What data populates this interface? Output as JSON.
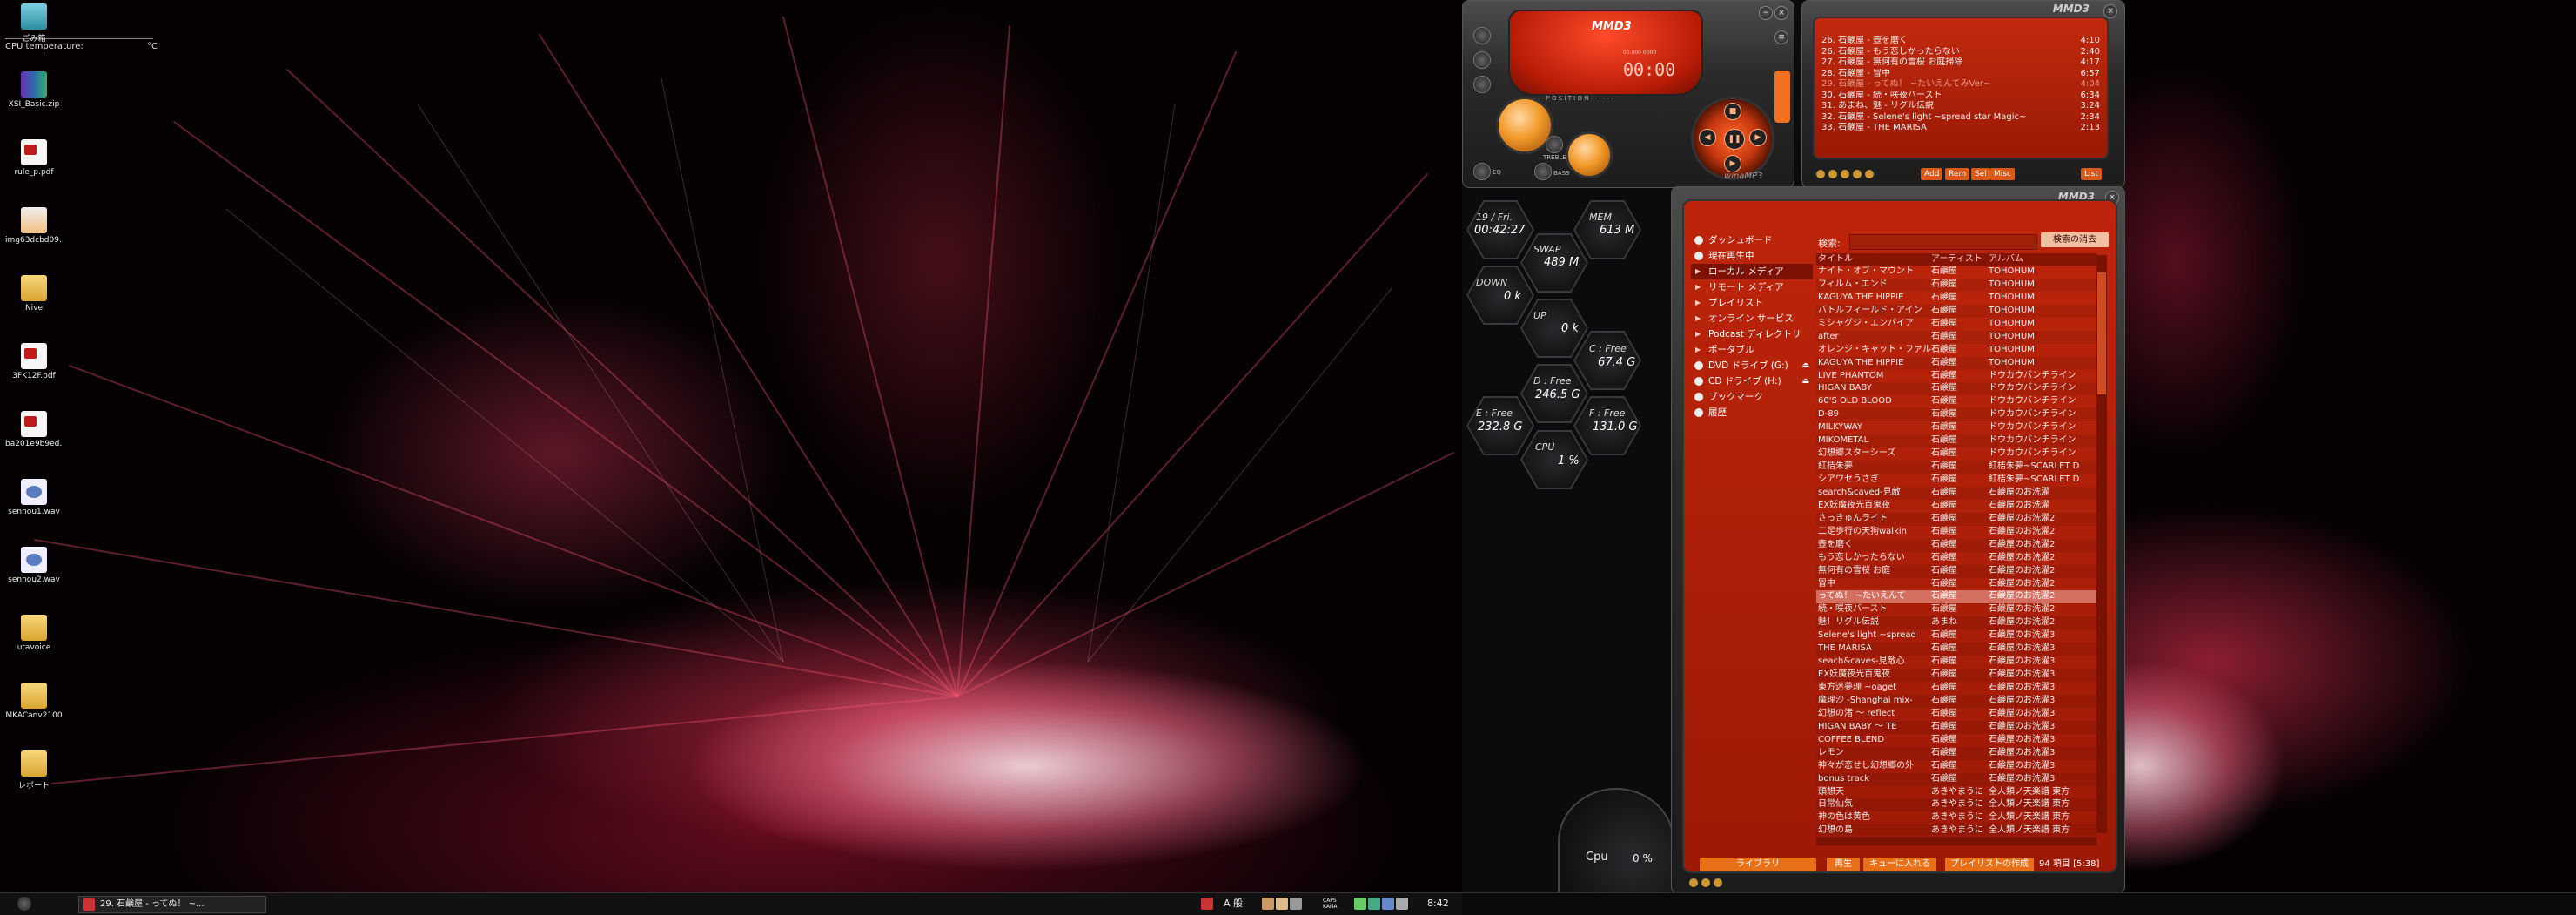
{
  "desktop": {
    "cpu_temp_label": "CPU temperature:",
    "cpu_temp_unit": "°C",
    "icons": [
      {
        "label": "ごみ箱",
        "kind": "bin"
      },
      {
        "label": "XSI_Basic.zip",
        "kind": "zip"
      },
      {
        "label": "rule_p.pdf",
        "kind": "pdf"
      },
      {
        "label": "img63dcbd09...",
        "kind": "img"
      },
      {
        "label": "Nive",
        "kind": "folder"
      },
      {
        "label": "3FK12F.pdf",
        "kind": "pdf"
      },
      {
        "label": "ba201e9b9ed...",
        "kind": "pdf"
      },
      {
        "label": "sennou1.wav",
        "kind": "wav"
      },
      {
        "label": "sennou2.wav",
        "kind": "wav"
      },
      {
        "label": "utavoice",
        "kind": "folder"
      },
      {
        "label": "MKACanv2100",
        "kind": "folder"
      },
      {
        "label": "レポート",
        "kind": "folder"
      }
    ]
  },
  "taskbar": {
    "task_label": "29. 石鹸屋 - ってぬ！ ~...",
    "ime_text": "A 般",
    "caps_text": "CAPS\nKANA",
    "clock": "8:42"
  },
  "meters": {
    "date": "19 / Fri.",
    "time": "00:42:27",
    "mem_label": "MEM",
    "mem_value": "613 M",
    "swap_label": "SWAP",
    "swap_value": "489 M",
    "down_label": "DOWN",
    "down_value": "0 k",
    "up_label": "UP",
    "up_value": "0 k",
    "c_label": "C : Free",
    "c_value": "67.4 G",
    "d_label": "D : Free",
    "d_value": "246.5 G",
    "e_label": "E : Free",
    "e_value": "232.8 G",
    "f_label": "F : Free",
    "f_value": "131.0 G",
    "cpu_label": "CPU",
    "cpu_value": "1 %",
    "dial_label": "Cpu",
    "dial_value": "0 %"
  },
  "player": {
    "brand": "MMD3",
    "lcd_small": "00.000 0000",
    "lcd_time": "00:00",
    "marquee": "- - - - - - P O S I T I O N - - - - - -",
    "bottom_brand": "winaMP3",
    "btn_eq": "EQ",
    "btn_treble": "TREBLE",
    "btn_bass": "BASS"
  },
  "playlist": {
    "brand": "MMD3",
    "rows": [
      {
        "title": "26. 石鹸屋 - 壺を磨く",
        "dur": "4:10",
        "dim": false
      },
      {
        "title": "26. 石鹸屋 - もう恋しかったらない",
        "dur": "2:40",
        "dim": false
      },
      {
        "title": "27. 石鹸屋 - 無何有の雪桜 お庭掃除",
        "dur": "4:17",
        "dim": false
      },
      {
        "title": "28. 石鹸屋 - 冒中",
        "dur": "6:57",
        "dim": false
      },
      {
        "title": "29. 石鹸屋 - ってぬ！ ~たいえんてみVer~",
        "dur": "4:04",
        "dim": true
      },
      {
        "title": "30. 石鹸屋 - 続・咲夜バースト",
        "dur": "6:34",
        "dim": false
      },
      {
        "title": "31. あまね、魅 - リグル伝説",
        "dur": "3:24",
        "dim": false
      },
      {
        "title": "32. 石鹸屋 - Selene's light ~spread star Magic~",
        "dur": "2:34",
        "dim": false
      },
      {
        "title": "33. 石鹸屋 - THE MARISA",
        "dur": "2:13",
        "dim": false
      }
    ],
    "btn_add": "Add",
    "btn_rem": "Rem",
    "btn_sel": "Sel",
    "btn_misc": "Misc",
    "btn_list": "List"
  },
  "library": {
    "brand": "MMD3",
    "nav": [
      {
        "label": "ダッシュボード",
        "sel": false,
        "arrow": false,
        "eject": false
      },
      {
        "label": "現在再生中",
        "sel": false,
        "arrow": false,
        "eject": false
      },
      {
        "label": "ローカル メディア",
        "sel": true,
        "arrow": true,
        "eject": false
      },
      {
        "label": "リモート メディア",
        "sel": false,
        "arrow": true,
        "eject": false
      },
      {
        "label": "プレイリスト",
        "sel": false,
        "arrow": true,
        "eject": false
      },
      {
        "label": "オンライン サービス",
        "sel": false,
        "arrow": true,
        "eject": false
      },
      {
        "label": "Podcast ディレクトリ",
        "sel": false,
        "arrow": true,
        "eject": false
      },
      {
        "label": "ポータブル",
        "sel": false,
        "arrow": true,
        "eject": false
      },
      {
        "label": "DVD ドライブ (G:)",
        "sel": false,
        "arrow": false,
        "eject": true
      },
      {
        "label": "CD ドライブ (H:)",
        "sel": false,
        "arrow": false,
        "eject": true
      },
      {
        "label": "ブックマーク",
        "sel": false,
        "arrow": false,
        "eject": false
      },
      {
        "label": "履歴",
        "sel": false,
        "arrow": false,
        "eject": false
      }
    ],
    "search_label": "検索:",
    "search_value": "",
    "search_clear": "検索の消去",
    "columns": [
      "タイトル",
      "アーティスト",
      "アルバム"
    ],
    "rows": [
      [
        "ナイト・オブ・マウント",
        "石鹸屋",
        "TOHOHUM"
      ],
      [
        "フィルム・エンド",
        "石鹸屋",
        "TOHOHUM"
      ],
      [
        "KAGUYA THE HIPPIE",
        "石鹸屋",
        "TOHOHUM"
      ],
      [
        "バトルフィールド・アイン",
        "石鹸屋",
        "TOHOHUM"
      ],
      [
        "ミシャグジ・エンパイア",
        "石鹸屋",
        "TOHOHUM"
      ],
      [
        "after",
        "石鹸屋",
        "TOHOHUM"
      ],
      [
        "オレンジ・キャット・ファル",
        "石鹸屋",
        "TOHOHUM"
      ],
      [
        "KAGUYA THE HIPPIE",
        "石鹸屋",
        "TOHOHUM"
      ],
      [
        "LIVE PHANTOM",
        "石鹸屋",
        "ドウカウバンチライン"
      ],
      [
        "HIGAN BABY",
        "石鹸屋",
        "ドウカウバンチライン"
      ],
      [
        "60'S OLD BLOOD",
        "石鹸屋",
        "ドウカウバンチライン"
      ],
      [
        "D-89",
        "石鹸屋",
        "ドウカウバンチライン"
      ],
      [
        "MILKYWAY",
        "石鹸屋",
        "ドウカウバンチライン"
      ],
      [
        "MIKOMETAL",
        "石鹸屋",
        "ドウカウバンチライン"
      ],
      [
        "幻想郷スターシーズ",
        "石鹸屋",
        "ドウカウバンチライン"
      ],
      [
        "紅桔朱夢",
        "石鹸屋",
        "紅桔朱夢~SCARLET D"
      ],
      [
        "シアワセうさぎ",
        "石鹸屋",
        "紅桔朱夢~SCARLET D"
      ],
      [
        "search&caved-見敵",
        "石鹸屋",
        "石鹸屋のお洗濯"
      ],
      [
        "EX妖魔夜光百鬼夜",
        "石鹸屋",
        "石鹸屋のお洗濯"
      ],
      [
        "さっきゅんライト",
        "石鹸屋",
        "石鹸屋のお洗濯2"
      ],
      [
        "二足歩行の天狗walkin",
        "石鹸屋",
        "石鹸屋のお洗濯2"
      ],
      [
        "壺を磨く",
        "石鹸屋",
        "石鹸屋のお洗濯2"
      ],
      [
        "もう恋しかったらない",
        "石鹸屋",
        "石鹸屋のお洗濯2"
      ],
      [
        "無何有の雪桜 お庭",
        "石鹸屋",
        "石鹸屋のお洗濯2"
      ],
      [
        "冒中",
        "石鹸屋",
        "石鹸屋のお洗濯2"
      ],
      [
        "ってぬ！ ~たいえんて",
        "石鹸屋",
        "石鹸屋のお洗濯2"
      ],
      [
        "続・咲夜バースト",
        "石鹸屋",
        "石鹸屋のお洗濯2"
      ],
      [
        "魅！リグル伝説",
        "あまね",
        "石鹸屋のお洗濯2"
      ],
      [
        "Selene's light ~spread",
        "石鹸屋",
        "石鹸屋のお洗濯3"
      ],
      [
        "THE MARISA",
        "石鹸屋",
        "石鹸屋のお洗濯3"
      ],
      [
        "seach&caves-見敵心",
        "石鹸屋",
        "石鹸屋のお洗濯3"
      ],
      [
        "EX妖魔夜光百鬼夜",
        "石鹸屋",
        "石鹸屋のお洗濯3"
      ],
      [
        "東方迷夢理 ~oaget",
        "石鹸屋",
        "石鹸屋のお洗濯3"
      ],
      [
        "魔理沙 -Shanghai mix-",
        "石鹸屋",
        "石鹸屋のお洗濯3"
      ],
      [
        "幻想の渚 ～ reflect",
        "石鹸屋",
        "石鹸屋のお洗濯3"
      ],
      [
        "HIGAN BABY ～ TE",
        "石鹸屋",
        "石鹸屋のお洗濯3"
      ],
      [
        "COFFEE BLEND",
        "石鹸屋",
        "石鹸屋のお洗濯3"
      ],
      [
        "レモン",
        "石鹸屋",
        "石鹸屋のお洗濯3"
      ],
      [
        "神々が恋せし幻想郷の外",
        "石鹸屋",
        "石鹸屋のお洗濯3"
      ],
      [
        "bonus track",
        "石鹸屋",
        "石鹸屋のお洗濯3"
      ],
      [
        "頭想天",
        "あきやまうに",
        "全人類ノ天楽譜 東方"
      ],
      [
        "日常仙気",
        "あきやまうに",
        "全人類ノ天楽譜 東方"
      ],
      [
        "神の色は黄色",
        "あきやまうに",
        "全人類ノ天楽譜 東方"
      ],
      [
        "幻想の島",
        "あきやまうに",
        "全人類ノ天楽譜 東方"
      ]
    ],
    "selected_row": 25,
    "btn_library": "ライブラリ",
    "btn_play": "再生",
    "btn_queue": "キューに入れる",
    "btn_create_pl": "プレイリストの作成",
    "status": "94 項目 [5:38]"
  },
  "colors": {
    "accent_orange": "#e87018",
    "skin_red": "#bd250a",
    "selection": "#d47060"
  }
}
